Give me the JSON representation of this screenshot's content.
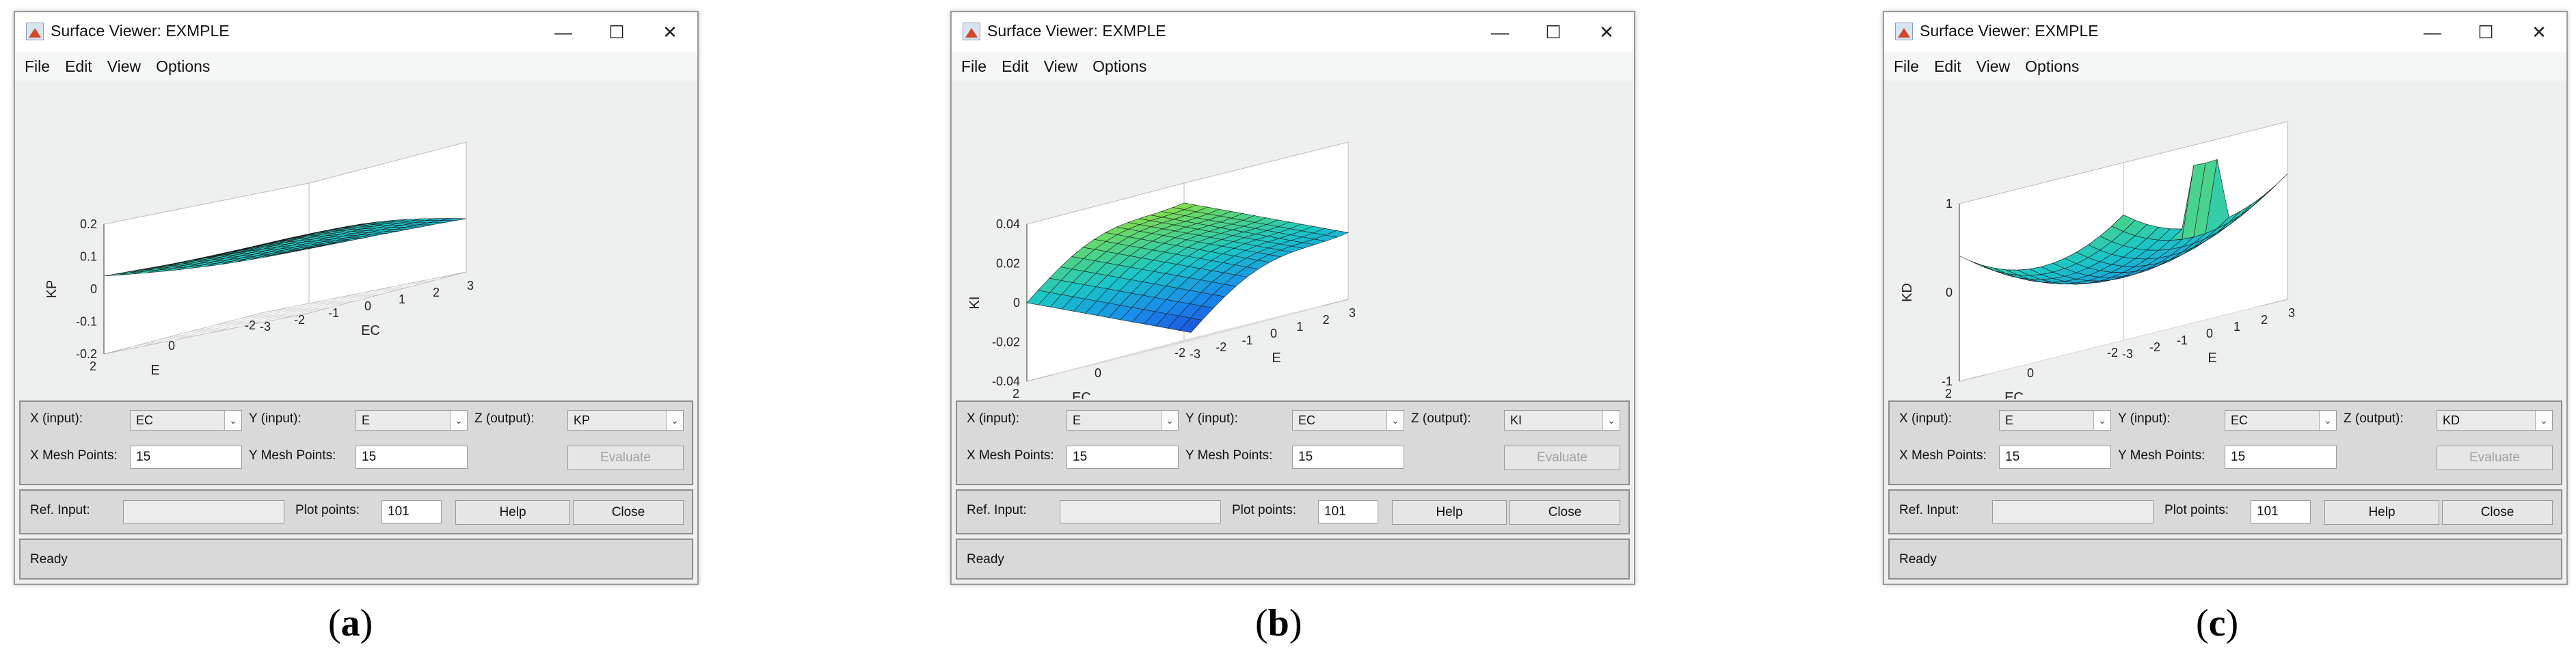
{
  "windows": [
    {
      "id": "a",
      "title": "Surface Viewer: EXMPLE",
      "menu": [
        "File",
        "Edit",
        "View",
        "Options"
      ],
      "axis_labels": {
        "z": "KP",
        "left_floor": "E",
        "right_floor": "EC"
      },
      "z_ticks": [
        "0.2",
        "0.1",
        "0",
        "-0.1",
        "-0.2"
      ],
      "left_ticks": [
        "2",
        "0",
        "-2"
      ],
      "right_ticks": [
        "-3",
        "-2",
        "-1",
        "0",
        "1",
        "2",
        "3"
      ],
      "x_input": "EC",
      "y_input": "E",
      "z_output": "KP",
      "x_mesh": "15",
      "y_mesh": "15",
      "plot_points": "101",
      "status": "Ready",
      "caption": "a"
    },
    {
      "id": "b",
      "title": "Surface Viewer: EXMPLE",
      "menu": [
        "File",
        "Edit",
        "View",
        "Options"
      ],
      "axis_labels": {
        "z": "KI",
        "left_floor": "EC",
        "right_floor": "E"
      },
      "z_ticks": [
        "0.04",
        "0.02",
        "0",
        "-0.02",
        "-0.04"
      ],
      "left_ticks": [
        "2",
        "0",
        "-2"
      ],
      "right_ticks": [
        "-3",
        "-2",
        "-1",
        "0",
        "1",
        "2",
        "3"
      ],
      "x_input": "E",
      "y_input": "EC",
      "z_output": "KI",
      "x_mesh": "15",
      "y_mesh": "15",
      "plot_points": "101",
      "status": "Ready",
      "caption": "b"
    },
    {
      "id": "c",
      "title": "Surface Viewer: EXMPLE",
      "menu": [
        "File",
        "Edit",
        "View",
        "Options"
      ],
      "axis_labels": {
        "z": "KD",
        "left_floor": "EC",
        "right_floor": "E"
      },
      "z_ticks": [
        "1",
        "0",
        "-1"
      ],
      "left_ticks": [
        "2",
        "0",
        "-2"
      ],
      "right_ticks": [
        "-3",
        "-2",
        "-1",
        "0",
        "1",
        "2",
        "3"
      ],
      "x_input": "E",
      "y_input": "EC",
      "z_output": "KD",
      "x_mesh": "15",
      "y_mesh": "15",
      "plot_points": "101",
      "status": "Ready",
      "caption": "c"
    }
  ],
  "labels": {
    "x_input": "X (input):",
    "y_input": "Y (input):",
    "z_output": "Z (output):",
    "x_mesh": "X Mesh Points:",
    "y_mesh": "Y Mesh Points:",
    "evaluate": "Evaluate",
    "ref_input": "Ref. Input:",
    "plot_points": "Plot points:",
    "help": "Help",
    "close": "Close",
    "minimize": "—",
    "maximize": "☐",
    "close_glyph": "✕"
  },
  "colors": {
    "surface_low": "#1f3fd8",
    "surface_mid": "#19c6c8",
    "surface_high": "#b4e61e"
  }
}
